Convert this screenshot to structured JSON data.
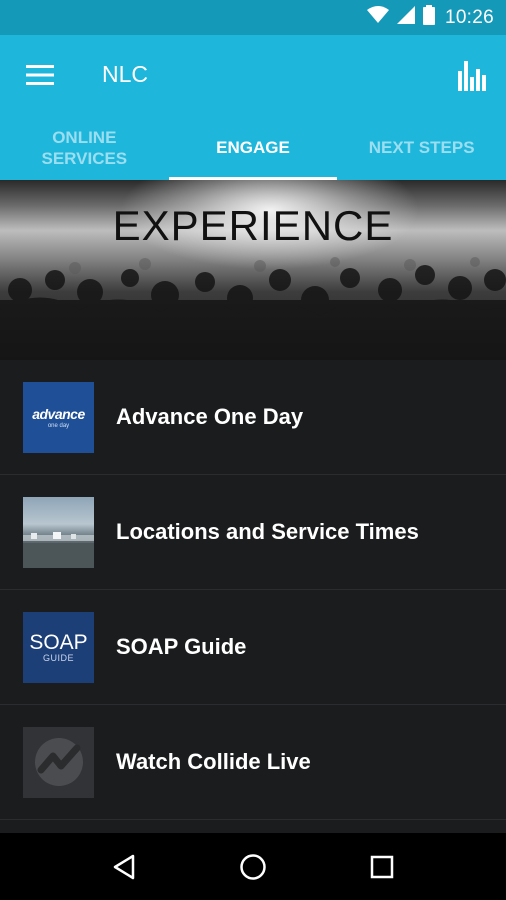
{
  "status_bar": {
    "time": "10:26",
    "icons": [
      "wifi-icon",
      "signal-icon",
      "battery-icon"
    ]
  },
  "app_bar": {
    "title": "NLC",
    "menu_icon": "hamburger-menu-icon",
    "action_icon": "bar-chart-icon",
    "background": "#1fb6dc",
    "status_background": "#1599b8"
  },
  "tabs": [
    {
      "label": "ONLINE\nSERVICES",
      "active": false
    },
    {
      "label": "ENGAGE",
      "active": true
    },
    {
      "label": "NEXT STEPS",
      "active": false
    }
  ],
  "banner": {
    "title": "EXPERIENCE"
  },
  "list": [
    {
      "label": "Advance One Day",
      "thumb_text": "advance",
      "thumb_subtext": "one day"
    },
    {
      "label": "Locations and Service Times"
    },
    {
      "label": "SOAP Guide",
      "thumb_text": "SOAP",
      "thumb_subtext": "GUIDE"
    },
    {
      "label": "Watch Collide Live"
    }
  ],
  "nav_bar": {
    "icons": [
      "back-icon",
      "home-icon",
      "recents-icon"
    ]
  }
}
